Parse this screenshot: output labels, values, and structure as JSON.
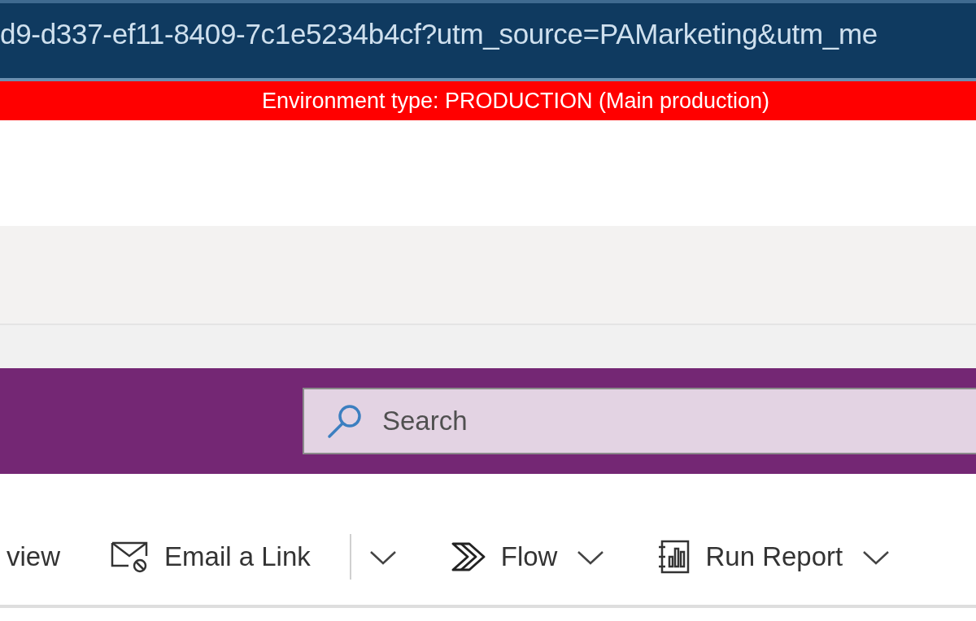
{
  "address_bar": {
    "url": "d9-d337-ef11-8409-7c1e5234b4cf?utm_source=PAMarketing&utm_me"
  },
  "environment_banner": {
    "text": "Environment type: PRODUCTION (Main production)"
  },
  "header": {
    "search": {
      "placeholder": "Search"
    }
  },
  "command_bar": {
    "items": [
      {
        "kind": "text",
        "label": "view"
      },
      {
        "kind": "email",
        "label": "Email a Link"
      },
      {
        "kind": "separator"
      },
      {
        "kind": "chevron"
      },
      {
        "kind": "flow",
        "label": "Flow"
      },
      {
        "kind": "chevron"
      },
      {
        "kind": "report",
        "label": "Run Report"
      },
      {
        "kind": "chevron"
      }
    ]
  }
}
